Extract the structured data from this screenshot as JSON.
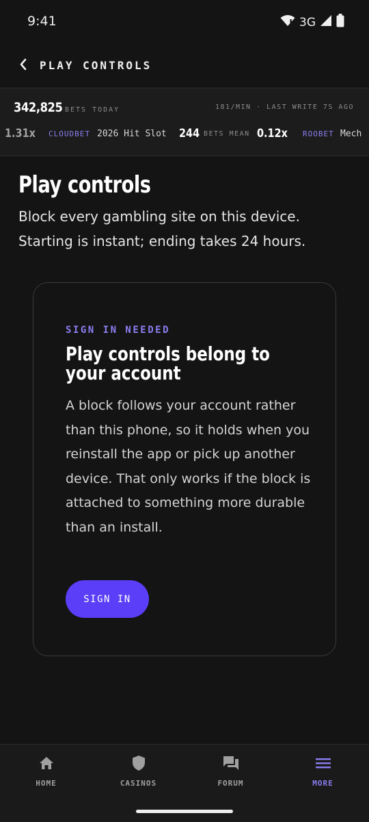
{
  "status_bar": {
    "time": "9:41",
    "network": "3G"
  },
  "header": {
    "title": "PLAY CONTROLS"
  },
  "ticker": {
    "bets_count": "342,825",
    "bets_label": "BETS TODAY",
    "rate_text": "181/MIN · LAST WRITE 7S AGO",
    "items": {
      "mult_1": "1.31x",
      "casino_1": "CLOUDBET",
      "game_1": "2026 Hit Slot",
      "mean_value": "244",
      "mean_label": "BETS MEAN",
      "mult_2": "0.12x",
      "casino_2": "ROOBET",
      "game_2": "Mech"
    }
  },
  "page": {
    "title": "Play controls",
    "description": "Block every gambling site on this device. Starting is instant; ending takes 24 hours."
  },
  "card": {
    "eyebrow": "SIGN IN NEEDED",
    "title": "Play controls belong to your account",
    "body": "A block follows your account rather than this phone, so it holds when you reinstall the app or pick up another device. That only works if the block is attached to something more durable than an install.",
    "button_label": "SIGN IN"
  },
  "bottom_nav": {
    "items": [
      {
        "label": "HOME",
        "icon": "home-icon",
        "active": false
      },
      {
        "label": "CASINOS",
        "icon": "shield-icon",
        "active": false
      },
      {
        "label": "FORUM",
        "icon": "forum-icon",
        "active": false
      },
      {
        "label": "MORE",
        "icon": "menu-icon",
        "active": true
      }
    ]
  },
  "colors": {
    "accent": "#5b3ef7",
    "accent_text": "#8a7ef0",
    "background": "#141414"
  }
}
